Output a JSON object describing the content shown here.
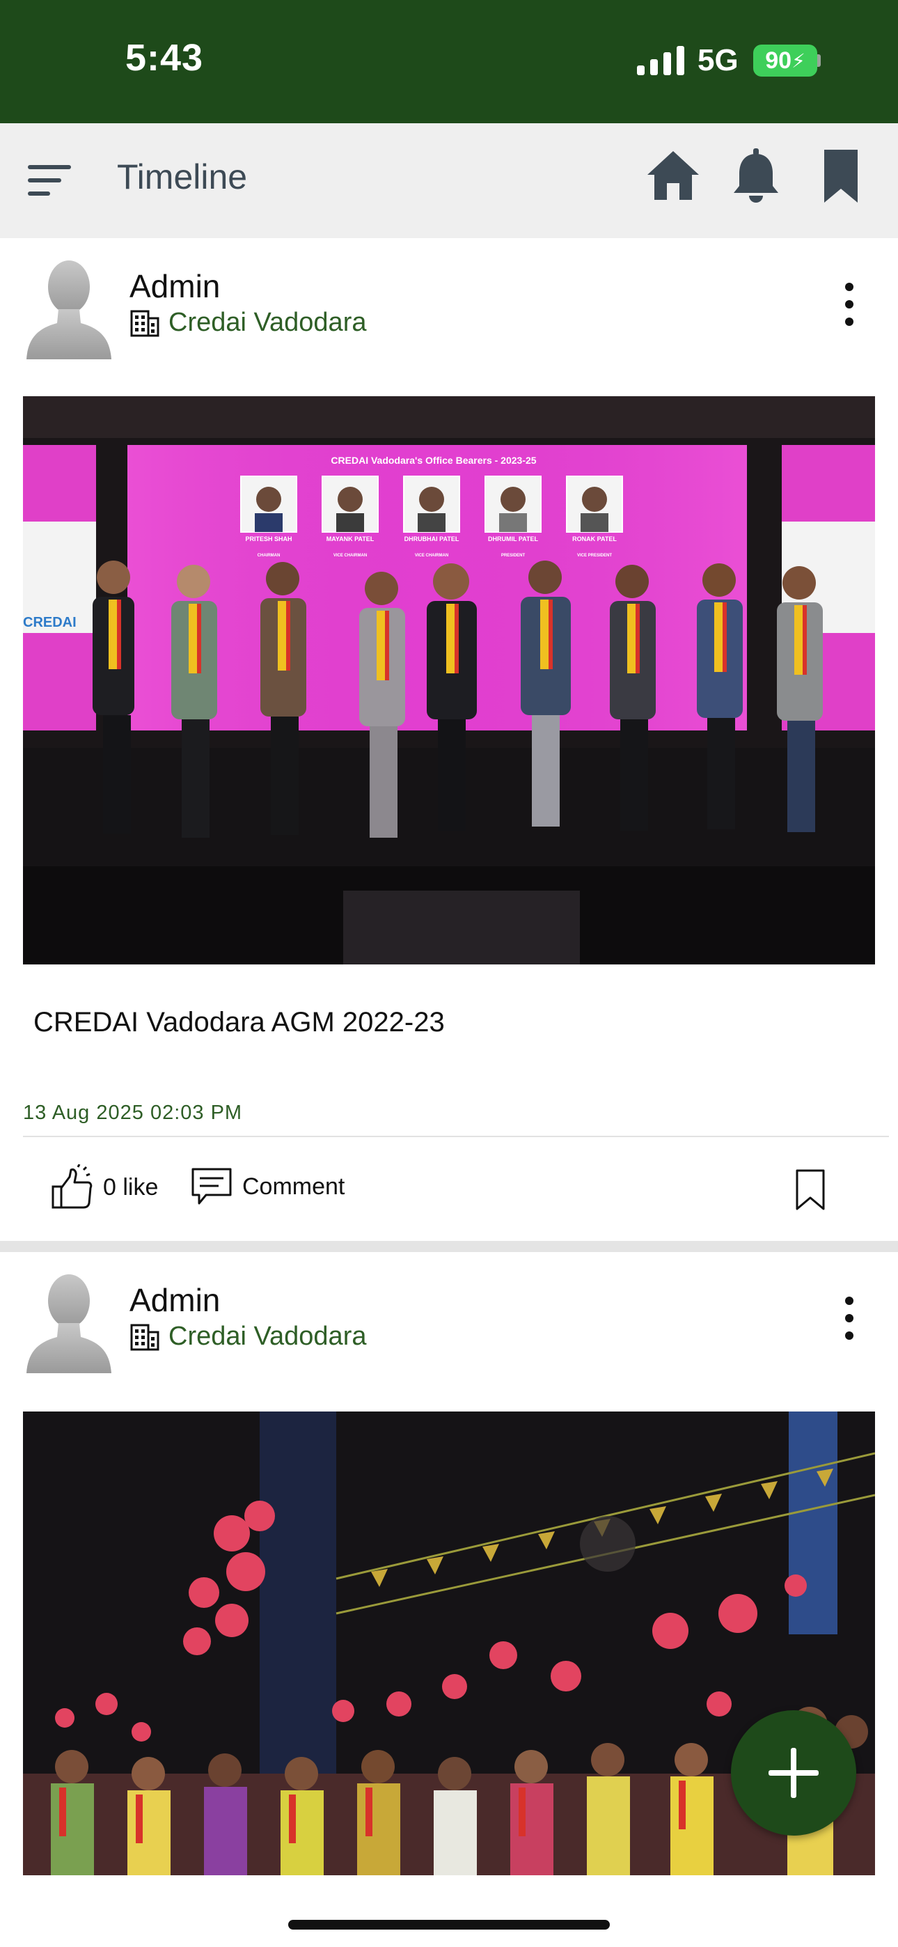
{
  "status_bar": {
    "time": "5:43",
    "network": "5G",
    "battery": "90"
  },
  "app_bar": {
    "title": "Timeline"
  },
  "posts": [
    {
      "author": "Admin",
      "organization": "Credai Vadodara",
      "banner": {
        "heading": "CREDAI Vadodara's Office Bearers - 2023-25",
        "side_left": "CREDAI",
        "bearers": [
          {
            "name": "PRITESH SHAH",
            "role": "CHAIRMAN"
          },
          {
            "name": "MAYANK PATEL",
            "role": "VICE CHAIRMAN"
          },
          {
            "name": "DHRUBHAI PATEL",
            "role": "VICE CHAIRMAN"
          },
          {
            "name": "DHRUMIL PATEL",
            "role": "PRESIDENT"
          },
          {
            "name": "RONAK PATEL",
            "role": "VICE PRESIDENT"
          }
        ]
      },
      "caption": "CREDAI Vadodara AGM 2022-23",
      "date": "13 Aug 2025 02:03 PM",
      "like_label": "0 like",
      "comment_label": "Comment"
    },
    {
      "author": "Admin",
      "organization": "Credai Vadodara"
    }
  ],
  "colors": {
    "brand_dark_green": "#1e4a1a",
    "accent_green_text": "#2e5e26",
    "banner_magenta": "#e23fd0",
    "app_bar_bg": "#efefef"
  }
}
